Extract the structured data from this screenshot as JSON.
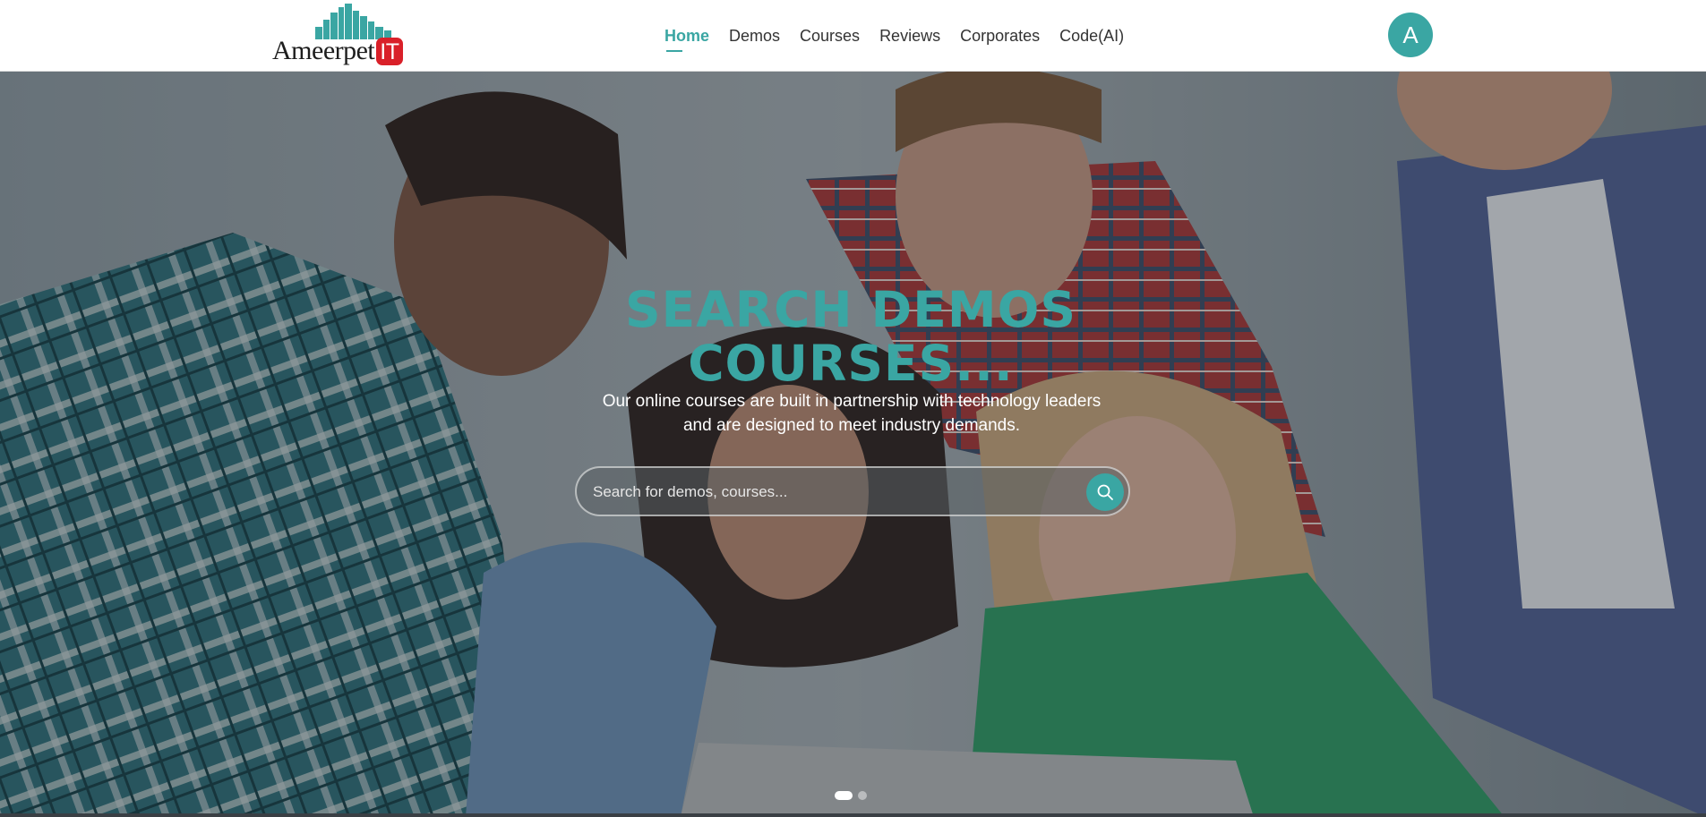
{
  "brand": {
    "name": "Ameerpet",
    "badge": "IT",
    "accent_color": "#3aa6a3",
    "badge_color": "#d92029"
  },
  "nav": {
    "items": [
      {
        "label": "Home",
        "active": true
      },
      {
        "label": "Demos",
        "active": false
      },
      {
        "label": "Courses",
        "active": false
      },
      {
        "label": "Reviews",
        "active": false
      },
      {
        "label": "Corporates",
        "active": false
      },
      {
        "label": "Code(AI)",
        "active": false
      }
    ]
  },
  "user": {
    "avatar_initial": "A"
  },
  "hero": {
    "title_line1": "SEARCH DEMOS",
    "title_line2": "COURSES...",
    "subtitle_line1": "Our online courses are built in partnership with technology leaders",
    "subtitle_line2": "and are designed to meet industry demands.",
    "search": {
      "placeholder": "Search for demos, courses...",
      "value": "",
      "icon": "search-icon"
    },
    "carousel": {
      "slides": 2,
      "active_index": 0
    }
  }
}
